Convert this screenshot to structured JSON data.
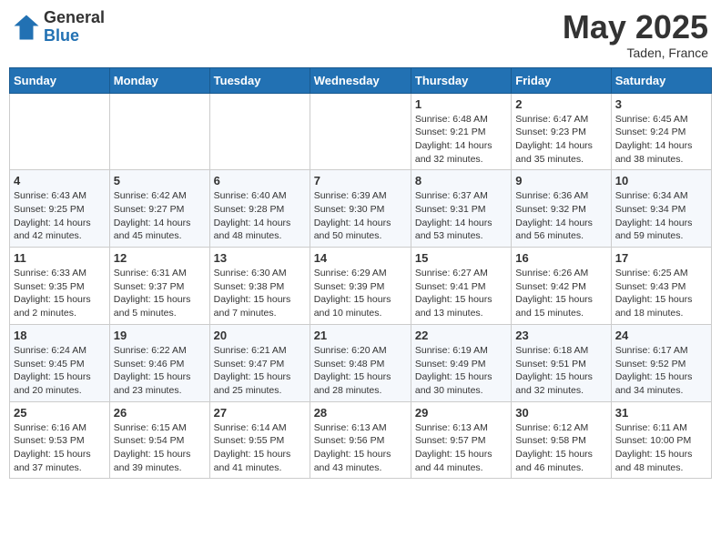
{
  "header": {
    "logo_general": "General",
    "logo_blue": "Blue",
    "month_year": "May 2025",
    "location": "Taden, France"
  },
  "days_of_week": [
    "Sunday",
    "Monday",
    "Tuesday",
    "Wednesday",
    "Thursday",
    "Friday",
    "Saturday"
  ],
  "weeks": [
    [
      {
        "day": "",
        "info": ""
      },
      {
        "day": "",
        "info": ""
      },
      {
        "day": "",
        "info": ""
      },
      {
        "day": "",
        "info": ""
      },
      {
        "day": "1",
        "info": "Sunrise: 6:48 AM\nSunset: 9:21 PM\nDaylight: 14 hours\nand 32 minutes."
      },
      {
        "day": "2",
        "info": "Sunrise: 6:47 AM\nSunset: 9:23 PM\nDaylight: 14 hours\nand 35 minutes."
      },
      {
        "day": "3",
        "info": "Sunrise: 6:45 AM\nSunset: 9:24 PM\nDaylight: 14 hours\nand 38 minutes."
      }
    ],
    [
      {
        "day": "4",
        "info": "Sunrise: 6:43 AM\nSunset: 9:25 PM\nDaylight: 14 hours\nand 42 minutes."
      },
      {
        "day": "5",
        "info": "Sunrise: 6:42 AM\nSunset: 9:27 PM\nDaylight: 14 hours\nand 45 minutes."
      },
      {
        "day": "6",
        "info": "Sunrise: 6:40 AM\nSunset: 9:28 PM\nDaylight: 14 hours\nand 48 minutes."
      },
      {
        "day": "7",
        "info": "Sunrise: 6:39 AM\nSunset: 9:30 PM\nDaylight: 14 hours\nand 50 minutes."
      },
      {
        "day": "8",
        "info": "Sunrise: 6:37 AM\nSunset: 9:31 PM\nDaylight: 14 hours\nand 53 minutes."
      },
      {
        "day": "9",
        "info": "Sunrise: 6:36 AM\nSunset: 9:32 PM\nDaylight: 14 hours\nand 56 minutes."
      },
      {
        "day": "10",
        "info": "Sunrise: 6:34 AM\nSunset: 9:34 PM\nDaylight: 14 hours\nand 59 minutes."
      }
    ],
    [
      {
        "day": "11",
        "info": "Sunrise: 6:33 AM\nSunset: 9:35 PM\nDaylight: 15 hours\nand 2 minutes."
      },
      {
        "day": "12",
        "info": "Sunrise: 6:31 AM\nSunset: 9:37 PM\nDaylight: 15 hours\nand 5 minutes."
      },
      {
        "day": "13",
        "info": "Sunrise: 6:30 AM\nSunset: 9:38 PM\nDaylight: 15 hours\nand 7 minutes."
      },
      {
        "day": "14",
        "info": "Sunrise: 6:29 AM\nSunset: 9:39 PM\nDaylight: 15 hours\nand 10 minutes."
      },
      {
        "day": "15",
        "info": "Sunrise: 6:27 AM\nSunset: 9:41 PM\nDaylight: 15 hours\nand 13 minutes."
      },
      {
        "day": "16",
        "info": "Sunrise: 6:26 AM\nSunset: 9:42 PM\nDaylight: 15 hours\nand 15 minutes."
      },
      {
        "day": "17",
        "info": "Sunrise: 6:25 AM\nSunset: 9:43 PM\nDaylight: 15 hours\nand 18 minutes."
      }
    ],
    [
      {
        "day": "18",
        "info": "Sunrise: 6:24 AM\nSunset: 9:45 PM\nDaylight: 15 hours\nand 20 minutes."
      },
      {
        "day": "19",
        "info": "Sunrise: 6:22 AM\nSunset: 9:46 PM\nDaylight: 15 hours\nand 23 minutes."
      },
      {
        "day": "20",
        "info": "Sunrise: 6:21 AM\nSunset: 9:47 PM\nDaylight: 15 hours\nand 25 minutes."
      },
      {
        "day": "21",
        "info": "Sunrise: 6:20 AM\nSunset: 9:48 PM\nDaylight: 15 hours\nand 28 minutes."
      },
      {
        "day": "22",
        "info": "Sunrise: 6:19 AM\nSunset: 9:49 PM\nDaylight: 15 hours\nand 30 minutes."
      },
      {
        "day": "23",
        "info": "Sunrise: 6:18 AM\nSunset: 9:51 PM\nDaylight: 15 hours\nand 32 minutes."
      },
      {
        "day": "24",
        "info": "Sunrise: 6:17 AM\nSunset: 9:52 PM\nDaylight: 15 hours\nand 34 minutes."
      }
    ],
    [
      {
        "day": "25",
        "info": "Sunrise: 6:16 AM\nSunset: 9:53 PM\nDaylight: 15 hours\nand 37 minutes."
      },
      {
        "day": "26",
        "info": "Sunrise: 6:15 AM\nSunset: 9:54 PM\nDaylight: 15 hours\nand 39 minutes."
      },
      {
        "day": "27",
        "info": "Sunrise: 6:14 AM\nSunset: 9:55 PM\nDaylight: 15 hours\nand 41 minutes."
      },
      {
        "day": "28",
        "info": "Sunrise: 6:13 AM\nSunset: 9:56 PM\nDaylight: 15 hours\nand 43 minutes."
      },
      {
        "day": "29",
        "info": "Sunrise: 6:13 AM\nSunset: 9:57 PM\nDaylight: 15 hours\nand 44 minutes."
      },
      {
        "day": "30",
        "info": "Sunrise: 6:12 AM\nSunset: 9:58 PM\nDaylight: 15 hours\nand 46 minutes."
      },
      {
        "day": "31",
        "info": "Sunrise: 6:11 AM\nSunset: 10:00 PM\nDaylight: 15 hours\nand 48 minutes."
      }
    ]
  ]
}
